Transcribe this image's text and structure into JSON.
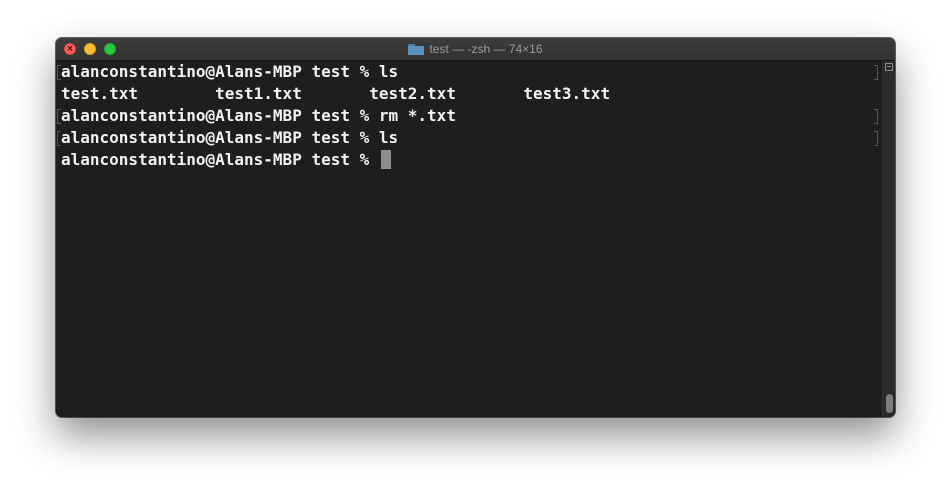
{
  "window": {
    "title": "test — -zsh — 74×16",
    "title_icon": "folder-icon",
    "controls": {
      "close_glyph": "×",
      "colors": {
        "close": "#fe5f57",
        "minimize": "#febc2e",
        "zoom": "#28c840"
      }
    }
  },
  "terminal": {
    "background": "#1e1e1e",
    "foreground": "#f2f2f2",
    "lines": [
      "alanconstantino@Alans-MBP test % ls",
      "test.txt        test1.txt       test2.txt       test3.txt",
      "alanconstantino@Alans-MBP test % rm *.txt",
      "alanconstantino@Alans-MBP test % ls",
      "alanconstantino@Alans-MBP test % "
    ],
    "cursor_color": "#8e8e8e"
  }
}
